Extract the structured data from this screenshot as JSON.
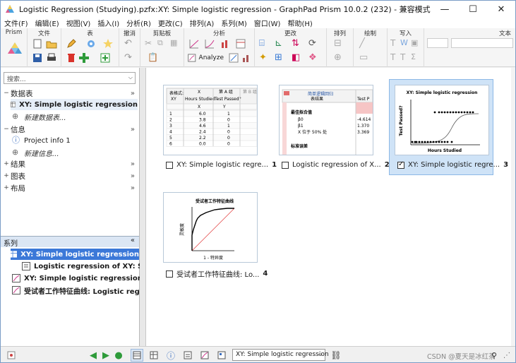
{
  "window": {
    "title": "Logistic Regression (Studying).pzfx:XY: Simple logistic regression - GraphPad Prism 10.0.2 (232) - 兼容模式",
    "minimize": "—",
    "maximize": "☐",
    "close": "✕"
  },
  "menu": [
    "文件(F)",
    "编辑(E)",
    "视图(V)",
    "插入(I)",
    "分析(R)",
    "更改(C)",
    "排列(A)",
    "系列(M)",
    "窗口(W)",
    "帮助(H)"
  ],
  "ribbon": {
    "groups": [
      "Prism",
      "文件",
      "表",
      "撤消",
      "剪贴板",
      "分析",
      "更改",
      "排列",
      "绘制",
      "写入",
      "文本"
    ],
    "analyze_label": "Analyze"
  },
  "navigator": {
    "search_placeholder": "搜索...",
    "sections": {
      "data": "数据表",
      "info": "信息",
      "results": "结果",
      "graphs": "图表",
      "layouts": "布局"
    },
    "data_items": [
      "XY: Simple logistic regression"
    ],
    "new_data": "新建数据表...",
    "info_items": [
      "Project info 1"
    ],
    "new_info": "新建信息..."
  },
  "series_panel": {
    "title": "系列",
    "collapse": "«",
    "items": [
      "XY: Simple logistic regression",
      "Logistic regression of XY: Simpl",
      "XY: Simple logistic regression",
      "受试者工作特征曲线: Logistic regress"
    ]
  },
  "gallery": [
    {
      "caption": "XY: Simple logistic regre...",
      "num": "1",
      "checked": false,
      "selected": false
    },
    {
      "caption": "Logistic regression of X...",
      "num": "2",
      "checked": false,
      "selected": false
    },
    {
      "caption": "XY: Simple logistic regre...",
      "num": "3",
      "checked": true,
      "selected": true
    },
    {
      "caption": "受试者工作特征曲线: Lo...",
      "num": "4",
      "checked": false,
      "selected": false
    }
  ],
  "thumb1": {
    "tab_format": "表格式:",
    "tab_xy": "XY",
    "col_x": "X",
    "col_a": "第 A 组",
    "col_b": "第 B 组",
    "sub_x": "Hours Studied",
    "sub_a": "Test Passed?",
    "hdr_x": "X",
    "hdr_y": "Y",
    "rows": [
      [
        "1",
        "6.0",
        "1"
      ],
      [
        "2",
        "3.8",
        "0"
      ],
      [
        "3",
        "4.6",
        "1"
      ],
      [
        "4",
        "2.4",
        "0"
      ],
      [
        "5",
        "2.2",
        "0"
      ],
      [
        "6",
        "0.0",
        "0"
      ]
    ]
  },
  "thumb2": {
    "title": "简单逻辑回归",
    "subtitle": "表结果",
    "col": "Test P",
    "section1": "最佳拟合值",
    "row_b0": "β0",
    "row_b1": "β1",
    "row_x50": "X 位于 50% 处",
    "v_b0": "-4.614",
    "v_b1": "1.370",
    "v_x50": "3.369",
    "section2": "标准误差"
  },
  "thumb3": {
    "title": "XY: Simple logistic regression",
    "ylabel": "Test Passed?",
    "xlabel": "Hours Studied"
  },
  "thumb4": {
    "title": "受试者工作特征曲线",
    "ylabel": "灵敏度",
    "xlabel": "1 - 特异度"
  },
  "statusbar": {
    "sheet_select": "XY: Simple logistic regression",
    "watermark": "CSDN @夏天是冰红茶"
  }
}
